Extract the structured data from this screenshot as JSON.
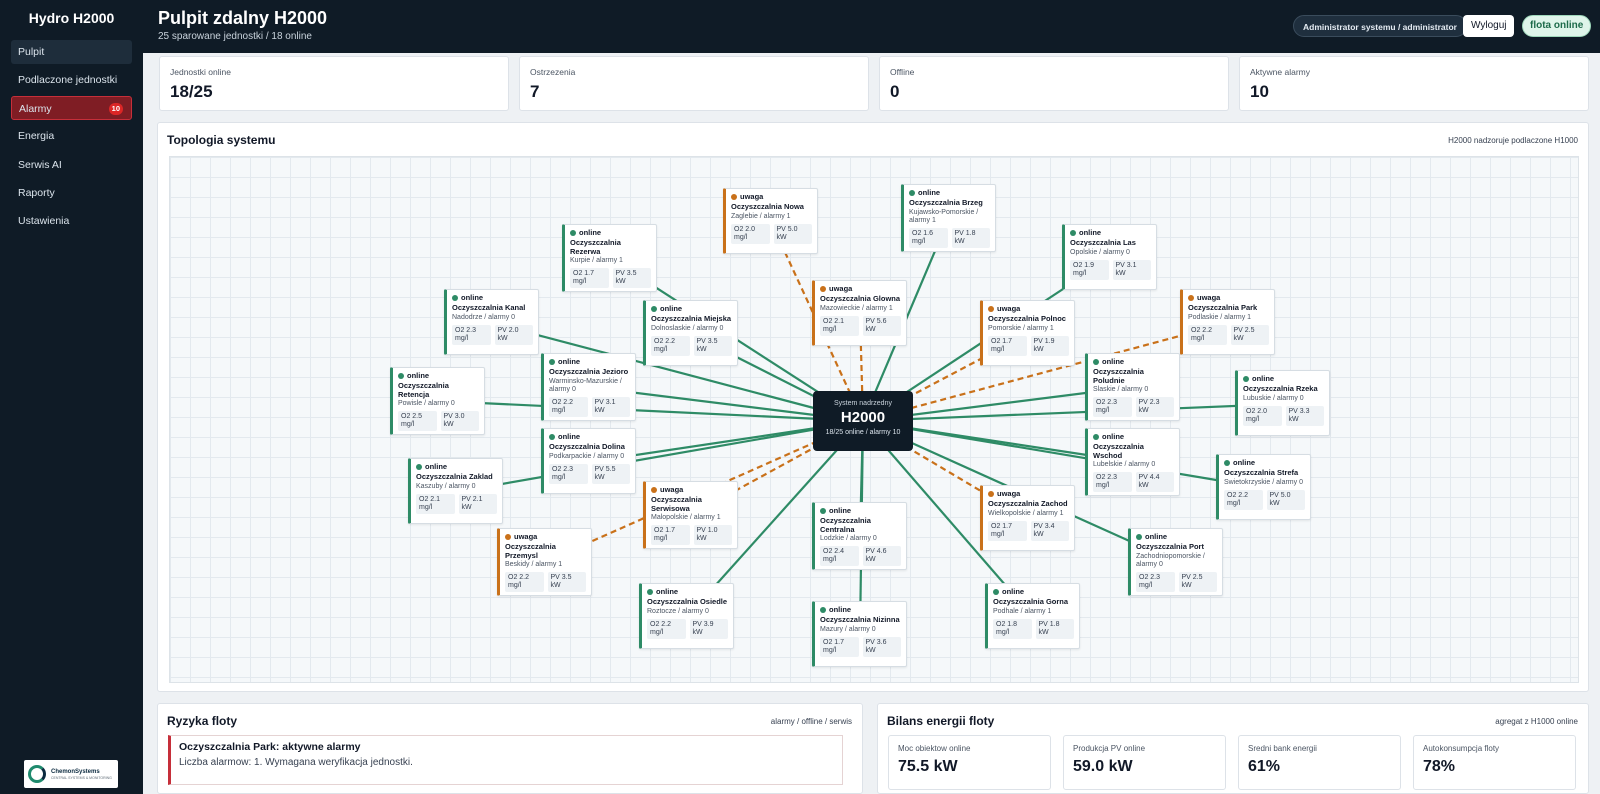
{
  "sidebar": {
    "brand": "Hydro H2000",
    "items": [
      {
        "label": "Pulpit"
      },
      {
        "label": "Podlaczone jednostki"
      },
      {
        "label": "Alarmy",
        "badge": "10"
      },
      {
        "label": "Energia"
      },
      {
        "label": "Serwis AI"
      },
      {
        "label": "Raporty"
      },
      {
        "label": "Ustawienia"
      }
    ],
    "logo": {
      "name": "ChemonSystems",
      "tagline": "CENTRAL SYSTEMS & MONITORING"
    }
  },
  "header": {
    "title": "Pulpit zdalny H2000",
    "subtitle": "25 sparowane jednostki / 18 online",
    "user": "Administrator systemu / administrator",
    "logout": "Wyloguj",
    "status": "flota online"
  },
  "stats": [
    {
      "label": "Jednostki online",
      "value": "18/25"
    },
    {
      "label": "Ostrzezenia",
      "value": "7"
    },
    {
      "label": "Offline",
      "value": "0"
    },
    {
      "label": "Aktywne alarmy",
      "value": "10"
    }
  ],
  "topology": {
    "title": "Topologia systemu",
    "note": "H2000 nadzoruje podlaczone H1000",
    "hub": {
      "top": "System nadrzedny",
      "name": "H2000",
      "sub": "18/25 online / alarmy 10"
    },
    "nodes": [
      {
        "status": "uwaga",
        "name": "Oczyszczalnia Nowa",
        "meta": "Zaglebie / alarmy 1",
        "o2": "O2 2.0 mg/l",
        "pv": "PV 5.0 kW"
      },
      {
        "status": "online",
        "name": "Oczyszczalnia Brzeg",
        "meta": "Kujawsko-Pomorskie / alarmy 1",
        "o2": "O2 1.6 mg/l",
        "pv": "PV 1.8 kW"
      },
      {
        "status": "online",
        "name": "Oczyszczalnia Rezerwa",
        "meta": "Kurpie / alarmy 1",
        "o2": "O2 1.7 mg/l",
        "pv": "PV 3.5 kW"
      },
      {
        "status": "online",
        "name": "Oczyszczalnia Las",
        "meta": "Opolskie / alarmy 0",
        "o2": "O2 1.9 mg/l",
        "pv": "PV 3.1 kW"
      },
      {
        "status": "uwaga",
        "name": "Oczyszczalnia Glowna",
        "meta": "Mazowieckie / alarmy 1",
        "o2": "O2 2.1 mg/l",
        "pv": "PV 5.6 kW"
      },
      {
        "status": "online",
        "name": "Oczyszczalnia Kanal",
        "meta": "Nadodrze / alarmy 0",
        "o2": "O2 2.3 mg/l",
        "pv": "PV 2.0 kW"
      },
      {
        "status": "online",
        "name": "Oczyszczalnia Miejska",
        "meta": "Dolnoslaskie / alarmy 0",
        "o2": "O2 2.2 mg/l",
        "pv": "PV 3.5 kW"
      },
      {
        "status": "uwaga",
        "name": "Oczyszczalnia Polnoc",
        "meta": "Pomorskie / alarmy 1",
        "o2": "O2 1.7 mg/l",
        "pv": "PV 1.9 kW"
      },
      {
        "status": "uwaga",
        "name": "Oczyszczalnia Park",
        "meta": "Podlaskie / alarmy 1",
        "o2": "O2 2.2 mg/l",
        "pv": "PV 2.5 kW"
      },
      {
        "status": "online",
        "name": "Oczyszczalnia Jezioro",
        "meta": "Warminsko-Mazurskie / alarmy 0",
        "o2": "O2 2.2 mg/l",
        "pv": "PV 3.1 kW"
      },
      {
        "status": "online",
        "name": "Oczyszczalnia Poludnie",
        "meta": "Slaskie / alarmy 0",
        "o2": "O2 2.3 mg/l",
        "pv": "PV 2.3 kW"
      },
      {
        "status": "online",
        "name": "Oczyszczalnia Retencja",
        "meta": "Powisle / alarmy 0",
        "o2": "O2 2.5 mg/l",
        "pv": "PV 3.0 kW"
      },
      {
        "status": "online",
        "name": "Oczyszczalnia Rzeka",
        "meta": "Lubuskie / alarmy 0",
        "o2": "O2 2.0 mg/l",
        "pv": "PV 3.3 kW"
      },
      {
        "status": "online",
        "name": "Oczyszczalnia Dolina",
        "meta": "Podkarpackie / alarmy 0",
        "o2": "O2 2.3 mg/l",
        "pv": "PV 5.5 kW"
      },
      {
        "status": "online",
        "name": "Oczyszczalnia Wschod",
        "meta": "Lubelskie / alarmy 0",
        "o2": "O2 2.3 mg/l",
        "pv": "PV 4.4 kW"
      },
      {
        "status": "online",
        "name": "Oczyszczalnia Zaklad",
        "meta": "Kaszuby / alarmy 0",
        "o2": "O2 2.1 mg/l",
        "pv": "PV 2.1 kW"
      },
      {
        "status": "online",
        "name": "Oczyszczalnia Strefa",
        "meta": "Swietokrzyskie / alarmy 0",
        "o2": "O2 2.2 mg/l",
        "pv": "PV 5.0 kW"
      },
      {
        "status": "uwaga",
        "name": "Oczyszczalnia Serwisowa",
        "meta": "Malopolskie / alarmy 1",
        "o2": "O2 1.7 mg/l",
        "pv": "PV 1.0 kW"
      },
      {
        "status": "uwaga",
        "name": "Oczyszczalnia Zachod",
        "meta": "Wielkopolskie / alarmy 1",
        "o2": "O2 1.7 mg/l",
        "pv": "PV 3.4 kW"
      },
      {
        "status": "online",
        "name": "Oczyszczalnia Centralna",
        "meta": "Lodzkie / alarmy 0",
        "o2": "O2 2.4 mg/l",
        "pv": "PV 4.6 kW"
      },
      {
        "status": "uwaga",
        "name": "Oczyszczalnia Przemysl",
        "meta": "Beskidy / alarmy 1",
        "o2": "O2 2.2 mg/l",
        "pv": "PV 3.5 kW"
      },
      {
        "status": "online",
        "name": "Oczyszczalnia Port",
        "meta": "Zachodniopomorskie / alarmy 0",
        "o2": "O2 2.3 mg/l",
        "pv": "PV 2.5 kW"
      },
      {
        "status": "online",
        "name": "Oczyszczalnia Osiedle",
        "meta": "Roztocze / alarmy 0",
        "o2": "O2 2.2 mg/l",
        "pv": "PV 3.9 kW"
      },
      {
        "status": "online",
        "name": "Oczyszczalnia Gorna",
        "meta": "Podhale / alarmy 1",
        "o2": "O2 1.8 mg/l",
        "pv": "PV 1.8 kW"
      },
      {
        "status": "online",
        "name": "Oczyszczalnia Nizinna",
        "meta": "Mazury / alarmy 0",
        "o2": "O2 1.7 mg/l",
        "pv": "PV 3.6 kW"
      }
    ]
  },
  "risks": {
    "title": "Ryzyka floty",
    "note": "alarmy / offline / serwis",
    "items": [
      {
        "title": "Oczyszczalnia Park: aktywne alarmy",
        "text": "Liczba alarmow: 1. Wymagana weryfikacja jednostki."
      }
    ]
  },
  "energy": {
    "title": "Bilans energii floty",
    "note": "agregat z H1000 online",
    "cards": [
      {
        "label": "Moc obiektow online",
        "value": "75.5 kW"
      },
      {
        "label": "Produkcja PV online",
        "value": "59.0 kW"
      },
      {
        "label": "Sredni bank energii",
        "value": "61%"
      },
      {
        "label": "Autokonsumpcja floty",
        "value": "78%"
      }
    ]
  },
  "colors": {
    "ok": "#2e8b66",
    "warn": "#c9711a",
    "alarm": "#c62f3a",
    "dark": "#0f1b26"
  }
}
